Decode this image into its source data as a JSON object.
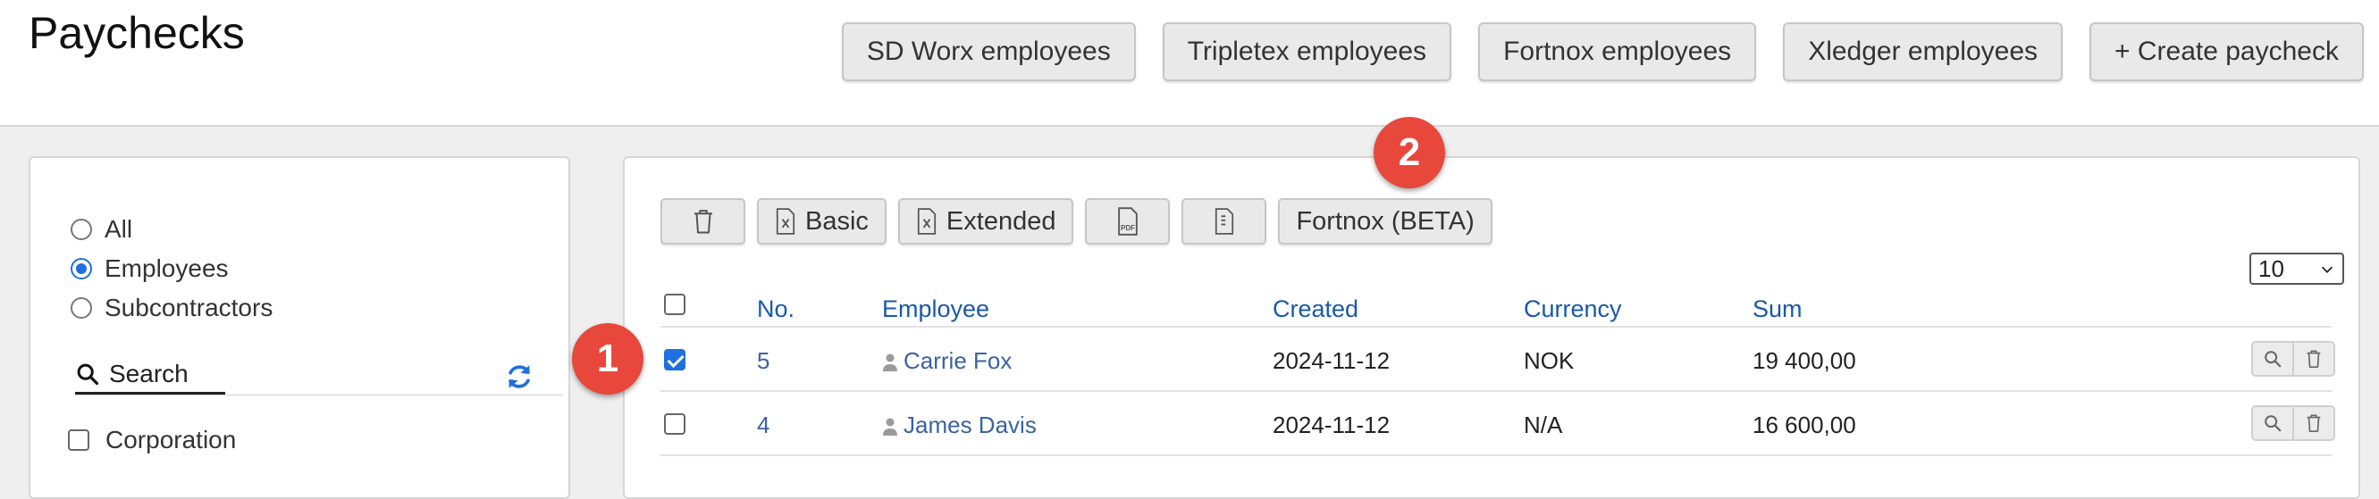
{
  "page": {
    "title": "Paychecks"
  },
  "top_actions": [
    "SD Worx employees",
    "Tripletex employees",
    "Fortnox employees",
    "Xledger employees",
    "+ Create paycheck"
  ],
  "filters": {
    "options": [
      "All",
      "Employees",
      "Subcontractors"
    ],
    "selected": "Employees",
    "search_label": "Search",
    "corporation_label": "Corporation"
  },
  "toolbar": {
    "basic_label": "Basic",
    "extended_label": "Extended",
    "fortnox_label": "Fortnox (BETA)",
    "pdf_text": "PDF"
  },
  "page_size": "10",
  "table": {
    "headers": [
      "No.",
      "Employee",
      "Created",
      "Currency",
      "Sum"
    ],
    "rows": [
      {
        "no": "5",
        "employee": "Carrie Fox",
        "created": "2024-11-12",
        "currency": "NOK",
        "sum": "19 400,00",
        "checked": true
      },
      {
        "no": "4",
        "employee": "James Davis",
        "created": "2024-11-12",
        "currency": "N/A",
        "sum": "16 600,00",
        "checked": false
      }
    ]
  },
  "callouts": [
    "1",
    "2"
  ],
  "colors": {
    "link": "#3a63a0",
    "header": "#1a59a8",
    "accent": "#1f6fe0",
    "callout": "#e8473b"
  }
}
